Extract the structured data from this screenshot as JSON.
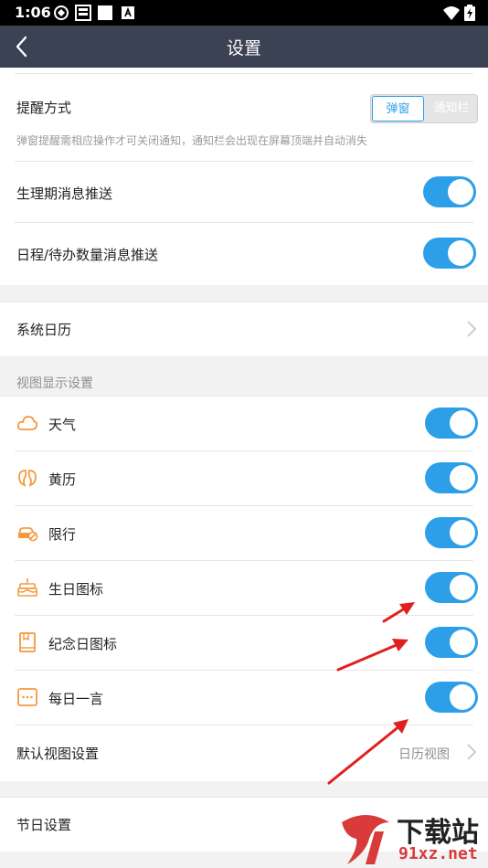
{
  "status_bar": {
    "time": "1:06"
  },
  "app_bar": {
    "title": "设置"
  },
  "reminder": {
    "label": "提醒方式",
    "options": [
      "弹窗",
      "通知栏"
    ],
    "hint": "弹窗提醒需相应操作才可关闭通知，通知栏会出现在屏幕顶端并自动消失"
  },
  "push": [
    {
      "label": "生理期消息推送",
      "on": true
    },
    {
      "label": "日程/待办数量消息推送",
      "on": true
    }
  ],
  "system_calendar": {
    "label": "系统日历"
  },
  "view_section": {
    "header": "视图显示设置",
    "items": [
      {
        "label": "天气",
        "icon": "cloud-icon",
        "on": true
      },
      {
        "label": "黄历",
        "icon": "almanac-icon",
        "on": true
      },
      {
        "label": "限行",
        "icon": "car-restriction-icon",
        "on": true
      },
      {
        "label": "生日图标",
        "icon": "cake-icon",
        "on": true
      },
      {
        "label": "纪念日图标",
        "icon": "book-icon",
        "on": true
      },
      {
        "label": "每日一言",
        "icon": "quote-icon",
        "on": true
      }
    ],
    "default_view": {
      "label": "默认视图设置",
      "value": "日历视图"
    }
  },
  "holiday": {
    "label": "节日设置"
  },
  "watermark": {
    "text": "下载站",
    "url": "91xz.net"
  },
  "colors": {
    "accent": "#2c9fe8",
    "appbar": "#3b4253",
    "icon_orange": "#f39a3e",
    "arrow": "#e02020"
  }
}
